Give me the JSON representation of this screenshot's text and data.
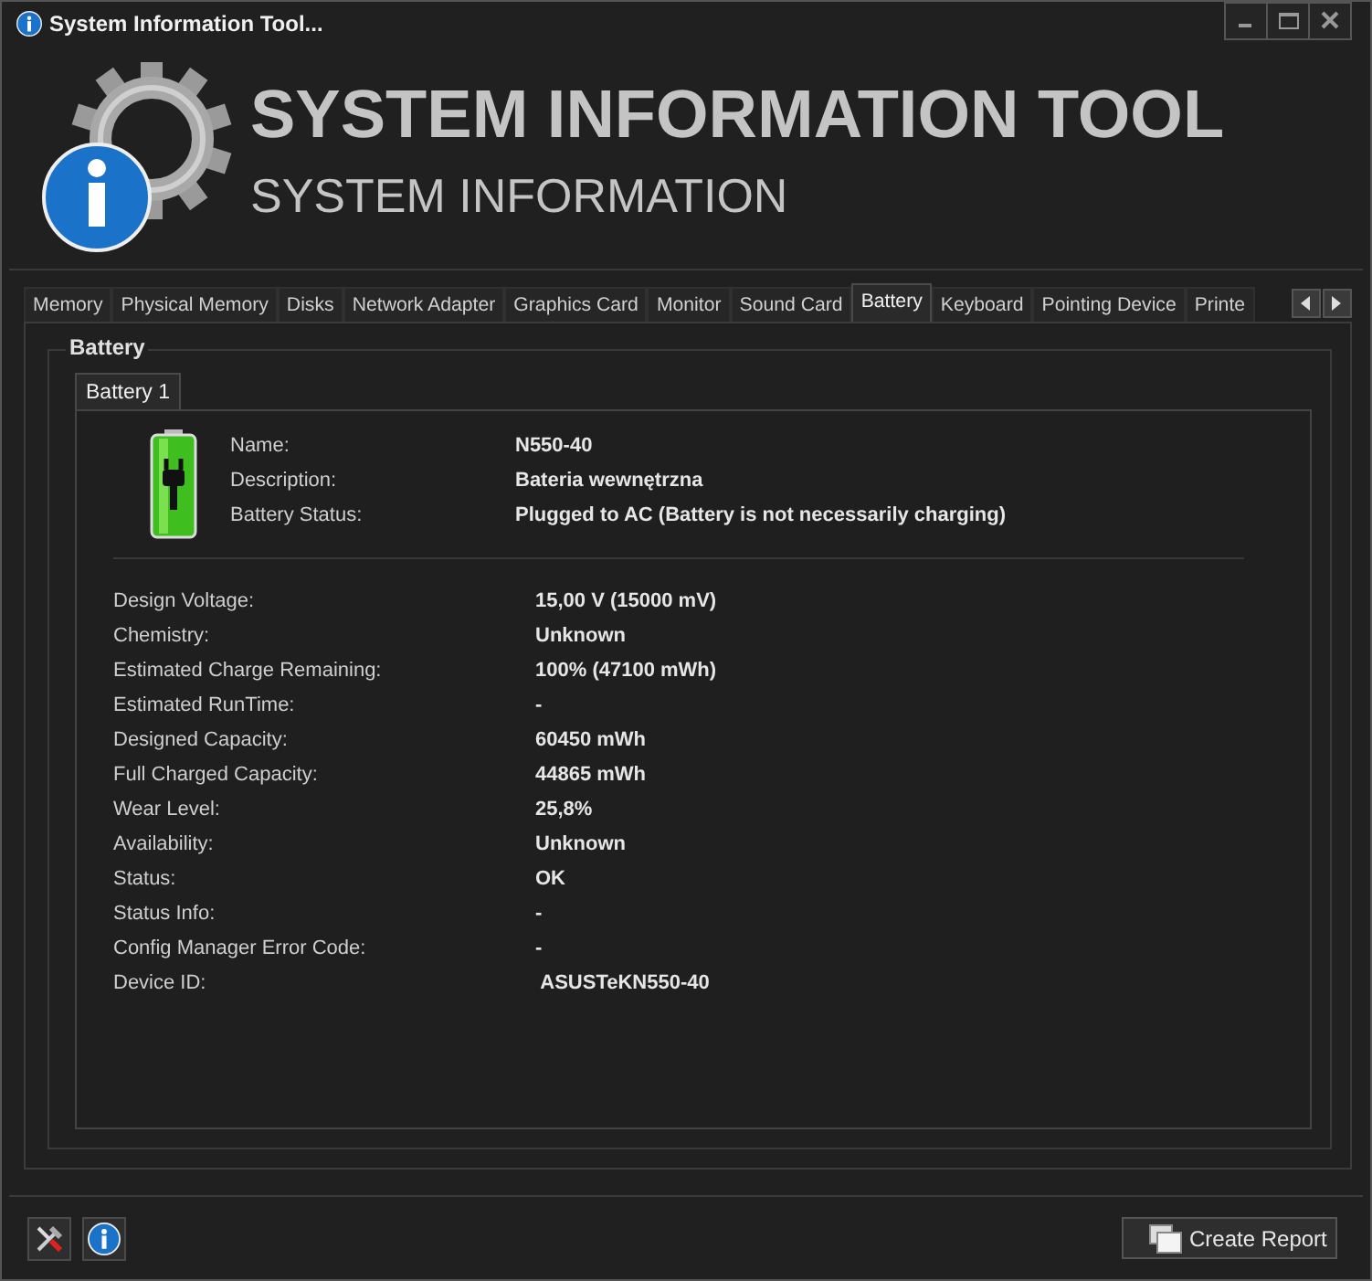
{
  "window": {
    "title": "System Information Tool..."
  },
  "header": {
    "title": "SYSTEM INFORMATION TOOL",
    "subtitle": "SYSTEM INFORMATION"
  },
  "tabs": [
    {
      "label": "Memory",
      "selected": false
    },
    {
      "label": "Physical Memory",
      "selected": false
    },
    {
      "label": "Disks",
      "selected": false
    },
    {
      "label": "Network Adapter",
      "selected": false
    },
    {
      "label": "Graphics Card",
      "selected": false
    },
    {
      "label": "Monitor",
      "selected": false
    },
    {
      "label": "Sound Card",
      "selected": false
    },
    {
      "label": "Battery",
      "selected": true
    },
    {
      "label": "Keyboard",
      "selected": false
    },
    {
      "label": "Pointing Device",
      "selected": false
    },
    {
      "label": "Printe",
      "selected": false
    }
  ],
  "group": {
    "title": "Battery"
  },
  "subtabs": [
    {
      "label": "Battery 1",
      "selected": true
    }
  ],
  "summary": [
    {
      "label": "Name:",
      "value": "N550-40"
    },
    {
      "label": "Description:",
      "value": "Bateria wewnętrzna"
    },
    {
      "label": "Battery Status:",
      "value": "Plugged to AC (Battery is not necessarily charging)"
    }
  ],
  "details": [
    {
      "label": "Design Voltage:",
      "value": "15,00 V (15000 mV)"
    },
    {
      "label": "Chemistry:",
      "value": "Unknown"
    },
    {
      "label": "Estimated Charge Remaining:",
      "value": "100% (47100 mWh)"
    },
    {
      "label": "Estimated RunTime:",
      "value": "-"
    },
    {
      "label": "Designed Capacity:",
      "value": "60450 mWh"
    },
    {
      "label": "Full Charged Capacity:",
      "value": "44865 mWh"
    },
    {
      "label": "Wear Level:",
      "value": "25,8%"
    },
    {
      "label": "Availability:",
      "value": "Unknown"
    },
    {
      "label": "Status:",
      "value": "OK"
    },
    {
      "label": "Status Info:",
      "value": "-"
    },
    {
      "label": "Config Manager Error Code:",
      "value": "-"
    },
    {
      "label": "Device ID:",
      "value": " ASUSTeKN550-40"
    }
  ],
  "footer": {
    "report_button": "Create Report"
  }
}
